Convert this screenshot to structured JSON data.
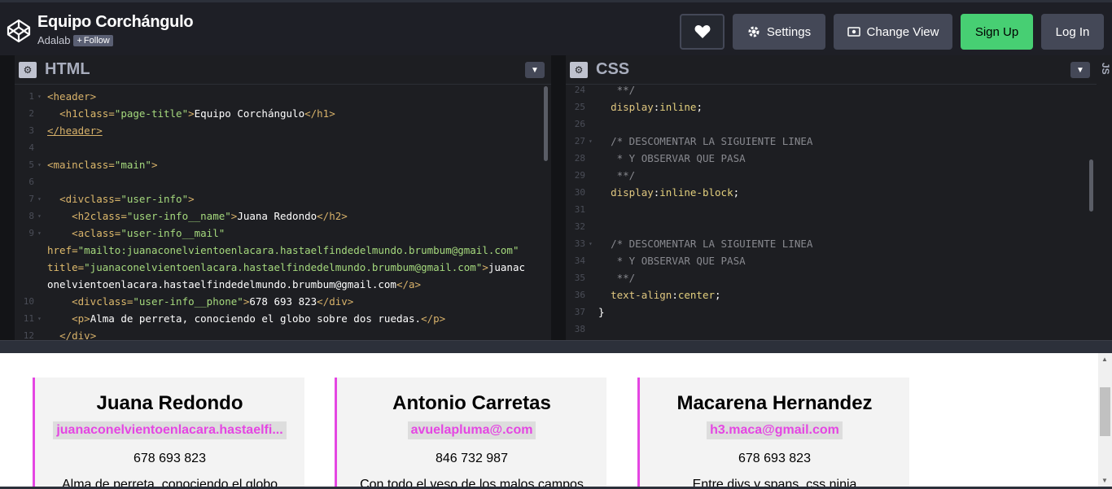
{
  "header": {
    "title": "Equipo Corchángulo",
    "author": "Adalab",
    "follow_label": "Follow",
    "buttons": {
      "settings": "Settings",
      "change_view": "Change View",
      "sign_up": "Sign Up",
      "log_in": "Log In"
    },
    "icons": [
      "codepen-logo-icon",
      "heart-icon",
      "gear-icon",
      "eye-icon"
    ]
  },
  "html_editor": {
    "title": "HTML",
    "lines": [
      {
        "n": "1",
        "fold": true
      },
      {
        "n": "2"
      },
      {
        "n": "3"
      },
      {
        "n": "4"
      },
      {
        "n": "5",
        "fold": true
      },
      {
        "n": "6"
      },
      {
        "n": "7",
        "fold": true
      },
      {
        "n": "8"
      },
      {
        "n": "9",
        "fold": true
      },
      {
        "n": ""
      },
      {
        "n": ""
      },
      {
        "n": ""
      },
      {
        "n": "10"
      },
      {
        "n": "11",
        "fold": true
      },
      {
        "n": "12"
      }
    ],
    "code": {
      "l1": "<header>",
      "l2a": "<h1 ",
      "l2b": "class=",
      "l2c": "\"page-title\"",
      "l2d": ">",
      "l2e": "Equipo Corchángulo",
      "l2f": "</h1>",
      "l3": "</header>",
      "l5a": "<main ",
      "l5b": "class=",
      "l5c": "\"main\"",
      "l5d": ">",
      "l7a": "<div ",
      "l7b": "class=",
      "l7c": "\"user-info\"",
      "l7d": ">",
      "l8a": "<h2 ",
      "l8b": "class=",
      "l8c": "\"user-info__name\"",
      "l8d": ">",
      "l8e": "Juana Redondo",
      "l8f": "</h2>",
      "l9a": "<a ",
      "l9b": "class=",
      "l9c": "\"user-info__mail\"",
      "l9w1a": "href=",
      "l9w1b": "\"mailto:juanaconelvientoenlacara.hastaelfindedelmundo.brumbum@gmail.com\"",
      "l9w2a": "title=",
      "l9w2b": "\"juanaconelvientoenlacara.hastaelfindedelmundo.brumbum@gmail.com\"",
      "l9w2c": ">",
      "l9w2d": "juanac",
      "l9w3a": "onelvientoenlacara.hastaelfindedelmundo.brumbum@gmail.com",
      "l9w3b": "</a>",
      "l10a": "<div ",
      "l10b": "class=",
      "l10c": "\"user-info__phone\"",
      "l10d": ">",
      "l10e": "678 693 823",
      "l10f": "</div>",
      "l11a": "<p>",
      "l11b": "Alma de perreta, conociendo el globo sobre dos ruedas.",
      "l11c": "</p>",
      "l12": "</div>"
    }
  },
  "css_editor": {
    "title": "CSS",
    "line_numbers": [
      "24",
      "25",
      "26",
      "27",
      "28",
      "29",
      "30",
      "31",
      "32",
      "33",
      "34",
      "35",
      "36",
      "37",
      "38"
    ],
    "code": {
      "l24": "**/",
      "l25a": "display",
      "l25b": ": ",
      "l25c": "inline",
      "l25d": ";",
      "l27": "/* DESCOMENTAR LA SIGUIENTE LINEA",
      "l28": " * Y OBSERVAR QUE PASA",
      "l29": " **/",
      "l30a": "display",
      "l30b": ": ",
      "l30c": "inline-block",
      "l30d": ";",
      "l33": "/* DESCOMENTAR LA SIGUIENTE LINEA",
      "l34": " * Y OBSERVAR QUE PASA",
      "l35": " **/",
      "l36a": "text-align",
      "l36b": ": ",
      "l36c": "center",
      "l36d": ";",
      "l37": "}"
    }
  },
  "js_tab": {
    "label": "JS"
  },
  "preview": {
    "accent": "#e546e3",
    "cards": [
      {
        "name": "Juana Redondo",
        "mail": "juanaconelvientoenlacara.hastaelfindedelmundo.brumbum@gmail.com",
        "mail_shown": "juanaconelvientoenlacara.hastaelfi...",
        "phone": "678 693 823",
        "desc": "Alma de perreta, conociendo el globo"
      },
      {
        "name": "Antonio Carretas",
        "mail_shown": "avuelapluma@.com",
        "phone": "846 732 987",
        "desc": "Con todo el veso de los malos campos"
      },
      {
        "name": "Macarena Hernandez",
        "mail_shown": "h3.maca@gmail.com",
        "phone": "678 693 823",
        "desc": "Entre divs y spans, css ninja"
      }
    ]
  }
}
